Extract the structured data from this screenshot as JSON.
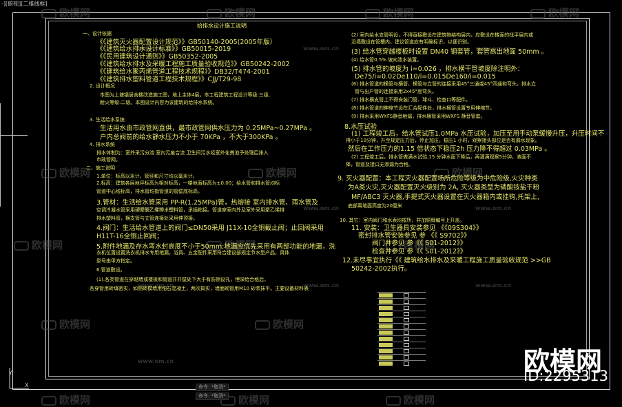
{
  "viewport_label": "-][俯视][二维线框]",
  "drawing": {
    "title": "给排水设计施工说明",
    "left_lines": [
      "一、设计依据",
      "《《建筑灭火器配置设计规范》》GB50140-2005(2005年版）",
      "《《建筑给水排水设计标准》》GB50015-2019",
      "《《民用建筑设计通则》》GB50352-2005",
      "《《建筑给水排水及采暖工程施工质量验收规范》》GB50242-2002",
      "《《建筑给水聚丙烯管道工程技术规程》》DB32/T474-2001",
      "《《建筑排水塑料管道工程技术规程》》CJJ/T29-98",
      "2. 设计概况",
      "本图为上塘镇居舍楼改造施工图，地上主体4层。本工程建筑工程设计等级:三级,",
      "耐火等级:二级。本图设计内容为该建筑的给排水系统。",
      "3. 生活给水系统",
      "生活用水由市政管网直供，最市政管网供水压力为 0.25MPa~0.27MPa 。",
      "户内总阀前的给水静水压力不小于 70KPa ，不大于300KPa 。",
      "4. 排水系统",
      "排水体制为：室外采污分流 室内污废合流 卫生间污水经室外化粪池予处理后排入",
      "市政管网。",
      "二、施工说明",
      "1.单位：标高以米计，管径和尺寸均以毫米计。",
      "2.标高：建筑各层地坪标高为相对标高，一楼地面标高为±0.00；给水管和排水管均标",
      "管道中心线标高，排水管均指管道的管壁底标高。",
      "3.管材：生活给水管采用 PP-R(1.25MPa)管，热熔接 室内排水管、雨水管及",
      "空调冷凝水管采用硬聚氯乙烯排水塑料管，承插粘接。管道穿室内外及室外采用聚乙烯排",
      "排水塑料管，横支管与立管连接处采用伸顶接。",
      "4.阀门：生活给水管道上的阀门≤DN50采用 J11X-10全铜截止阀；止回阀采用",
      "H11T-16全铜止回阀；",
      "5.附件地漏及存水弯水封高度不小于50mm;地漏应优先采用有两部功能的地漏，洗",
      "衣机位置设置洗衣机排水专用地漏，浴具、五金配件采用符合建设部规定节水型产品，具体",
      "型号由甲方指定。",
      "6.管道敷设。",
      "(1).各类管道在穿越墙或楼板和管道井井壁处下大于有防侧设孔，埋深给合格后，",
      "各穿管用砖填密实，如侧砖模墙用细石混凝土，两次捣实，墙面砌管用M10 砂浆抹平。主要设备材料表"
    ],
    "right_lines": [
      "(2) 室内给水支管明设，不得直接敷设在建筑物结构层内，应敷设在楼面的找平层内或",
      "沿墙敷设在管槽内，建议管道应有明确标识，以便识别。",
      "(3) 给水管穿越楼板时设置 DN40 钢套管，套管高出地面  50mm  。",
      "(4) 给水管0.5% 坡向泄水装置。",
      "(5) 排水管的坡度为 i=0.026 ，排水横干管坡度除注明外：",
      "De75/i=0.02De110/i=0.015De160/i=0.015",
      "(6) 排水管道的横管与横管、横管与立管的连接采用45°三通或45°四通和弯头。排水立",
      "管与出户管的连接采用2x45°度弯头。",
      "(7) 排水横支管上不得安装门管、球斗、检查口等配件。",
      "(8) 排水管道的伸缩节设在汇合配件处，排水横管设置专用伸缩节。",
      "(9) 排水采用WXFS静音地漏，排水横管采用WXFS 静音管套。",
      "8.水压试验",
      "(1) 工程竣工后，给水管试压1.0MPa 水压试验，加压至用手动泵缓慢升压，升压时间不",
      "得小于10分钟，升至规定压力后，停止加压，稳压1 小时，观察接头部位是否有漏水现象。",
      "然后在工作压力的1.15 倍状态下稳压2h 压力降不得超过 0.03MPa 。",
      "(2) 工程竣工后，排水管做满水试验,15 分钟水面下降后，再灌满观察5分钟，液面不",
      "降，管道及接口无渗漏为合格。",
      "9. 灭火器配置：本工程灭火器配置场所危险等级为中危险级,火灾种类",
      "为A类火灾,灭火器配置灭火级别为 2A, 灭火器类型为磷酸铵盐干粉",
      "MF/ABC3 灭火器,手提式灭火器设置在灭火器箱内或挂钩,托架上,",
      "底部离地面高度为20厘米",
      "10. 其它：室内阀门和水表均按所，并加铜牌编号上开盖。",
      "11. 安装：卫生器具安装参见  《《09S304》》",
      "密封排水管安装参见 参 《《 S9702》》",
      "阀门井参见 参《《 S01-2012》》",
      "检查井参见 参《《 S01-2012》》",
      "12.未尽事宜执行《《 建筑给水排水及采暖工程施工质量验收规范 >>GB",
      "50242-2002执行。"
    ]
  },
  "watermark": {
    "brand": "欧模网",
    "url": "www.om.cn",
    "big_brand": "欧模网",
    "id_label": "ID:2295313"
  },
  "command_line": {
    "line1": "命令: *取消*",
    "line2": "命令: *取消*"
  },
  "axis": {
    "y_label": "Y",
    "x_label": "X"
  }
}
